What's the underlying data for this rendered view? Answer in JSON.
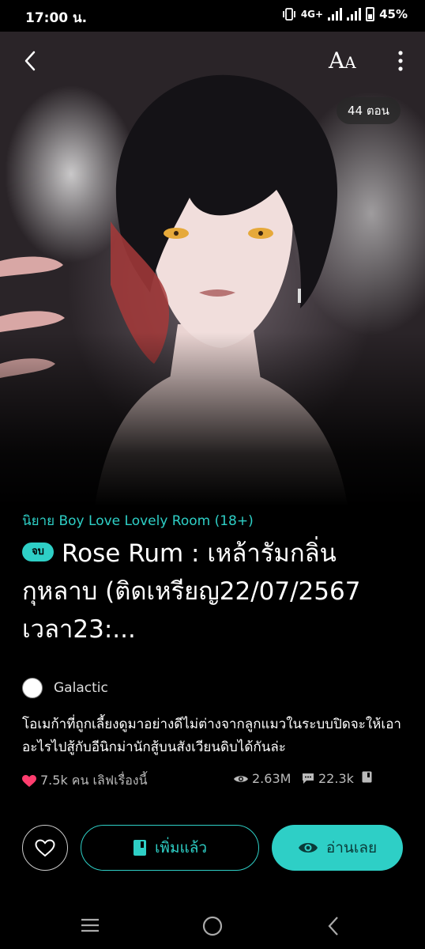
{
  "status": {
    "time": "17:00 น.",
    "network": "4G+",
    "battery": "45%"
  },
  "toolbar": {
    "back_icon": "chevron-left-icon",
    "font_label_big": "A",
    "font_label_small": "A",
    "more_icon": "more-vertical-icon"
  },
  "cover": {
    "episode_count": "44 ตอน"
  },
  "novel": {
    "category": "นิยาย Boy Love Lovely Room  (18+)",
    "status_badge": "จบ",
    "title": "Rose Rum : เหล้ารัมกลิ่นกุหลาบ (ติดเหรียญ22/07/2567 เวลา23:...",
    "author": "Galactic",
    "synopsis": "โอเมก้าที่ถูกเลี้ยงดูมาอย่างดีไม่ต่างจากลูกแมวในระบบปิดจะให้เอาอะไรไปสู้กับอีนิกม่านักสู้บนสังเวียนดิบได้กันล่ะ",
    "likes": "7.5k คน เลิฟเรื่องนี้",
    "views": "2.63M",
    "comments": "22.3k"
  },
  "actions": {
    "added_label": "เพิ่มแล้ว",
    "read_label": "อ่านเลย"
  },
  "colors": {
    "accent": "#2ecfc6",
    "heart": "#ff3d6e"
  }
}
